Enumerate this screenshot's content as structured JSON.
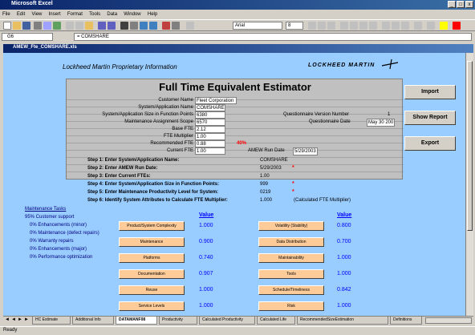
{
  "app": {
    "title": "Microsoft Excel",
    "window_controls": [
      "_",
      "□",
      "x"
    ]
  },
  "menu": [
    "File",
    "Edit",
    "View",
    "Insert",
    "Format",
    "Tools",
    "Data",
    "Window",
    "Help"
  ],
  "toolbar": {
    "font_name": "Arial",
    "font_size": "8"
  },
  "formula_bar": {
    "name_box": "G6",
    "formula": "= COMSHARE"
  },
  "workbook": {
    "title": "AMEW_Fte_COMSHARE.xls"
  },
  "sheet": {
    "header_note": "Lockheed Martin Proprietary Information",
    "logo": "LOCKHEED MARTIN"
  },
  "estimator": {
    "title": "Full Time Equivalent Estimator",
    "rows": [
      {
        "label": "Customer Name",
        "value": "Fleet Corporation"
      },
      {
        "label": "System/Application Name",
        "value": "COMSHARE"
      },
      {
        "label": "System/Application Size in Function Points",
        "value": "6380"
      },
      {
        "label": "Maintenance Assignment Scope",
        "value": "6570"
      },
      {
        "label": "Base FTE",
        "value": "2.12"
      },
      {
        "label": "FTE Multiplier",
        "value": "1.00"
      },
      {
        "label": "Recommended FTE",
        "value": "0.88"
      },
      {
        "label": "Current FTE",
        "value": "1.00"
      }
    ],
    "percent": "40%",
    "questionnaire_label": "Questionnaire Version Number",
    "questionnaire_value": "1",
    "date_label": "Questionnaire Date",
    "date_value": "May 30 200",
    "amew_label": "AMEW Run Date",
    "amew_value": "5/29/2003"
  },
  "buttons": {
    "import": "Import",
    "show_report": "Show Report",
    "export": "Export"
  },
  "steps": [
    {
      "label": "Step 1: Enter System/Application Name:",
      "value": "COMSHARE"
    },
    {
      "label": "Step 2: Enter AMEW Run Date:",
      "value": "5/29/2003"
    },
    {
      "label": "Step 3: Enter Current FTEs:",
      "value": "1.00"
    },
    {
      "label": "Step 4: Enter System/Application Size in Function Points:",
      "value": "999"
    },
    {
      "label": "Step 5: Enter Maintenance Productivity Level for System:",
      "value": "0219"
    },
    {
      "label": "Step 6: Identify System Attributes to Calculate FTE Multiplier:",
      "value": "1.000",
      "note": "(Calculated FTE Multiplier)"
    }
  ],
  "maintenance_tasks": {
    "title": "Maintenance Tasks",
    "items": [
      "95% Customer support",
      "0% Enhancements (minor)",
      "0% Maintenance (defect repairs)",
      "0% Warranty repairs",
      "0% Enhancements (major)",
      "0% Performance optimization"
    ]
  },
  "attributes": {
    "value_header": "Value",
    "left": [
      {
        "label": "Product/System Complexity",
        "value": "1.000"
      },
      {
        "label": "Maintenance",
        "value": "0.900"
      },
      {
        "label": "Platforms",
        "value": "0.740"
      },
      {
        "label": "Documentation",
        "value": "0.907"
      },
      {
        "label": "Reuse",
        "value": "1.000"
      },
      {
        "label": "Service Levels",
        "value": "1.000"
      }
    ],
    "right": [
      {
        "label": "Volatility (Stability)",
        "value": "0.800"
      },
      {
        "label": "Data Distribution",
        "value": "0.700"
      },
      {
        "label": "Maintainability",
        "value": "1.000"
      },
      {
        "label": "Tools",
        "value": "1.000"
      },
      {
        "label": "Schedule/Timeliness",
        "value": "0.842"
      },
      {
        "label": "Risk",
        "value": "1.000"
      }
    ]
  },
  "sheet_tabs": [
    {
      "label": "HC Estimate",
      "active": false
    },
    {
      "label": "Additional Info",
      "active": false
    },
    {
      "label": "DATAMANF08",
      "active": true
    },
    {
      "label": "Productivity",
      "active": false
    },
    {
      "label": "Calculated Productivity",
      "active": false
    },
    {
      "label": "Calculated Life",
      "active": false
    },
    {
      "label": "RecommendedSizeEstimation",
      "active": false
    },
    {
      "label": "Definitions",
      "active": false
    }
  ],
  "status": "Ready"
}
